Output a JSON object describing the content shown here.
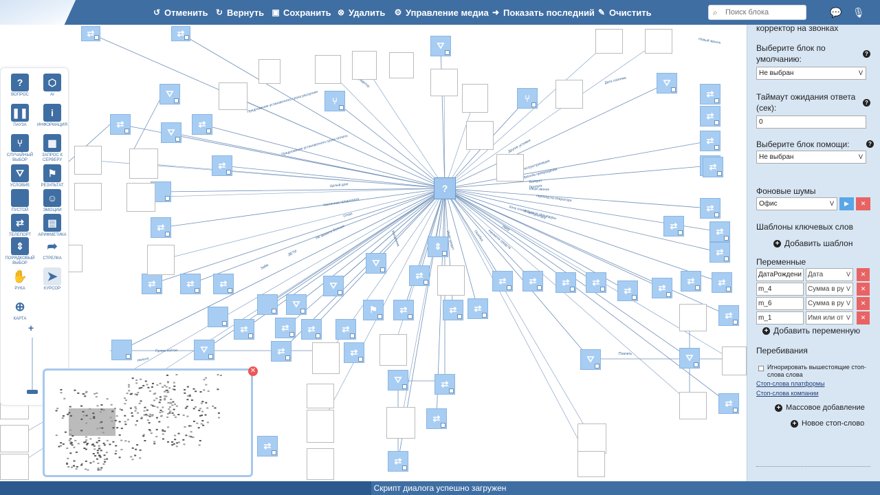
{
  "toolbar": {
    "undo": "Отменить",
    "redo": "Вернуть",
    "save": "Сохранить",
    "delete": "Удалить",
    "media": "Управление медиа",
    "show_last": "Показать последний",
    "clear": "Очистить",
    "search_placeholder": "Поиск блока"
  },
  "tools": [
    {
      "label": "ВОПРОС",
      "glyph": "?"
    },
    {
      "label": "AI",
      "glyph": "⬡"
    },
    {
      "label": "ПАУЗА",
      "glyph": "❚❚"
    },
    {
      "label": "ИНФОРМАЦИЯ",
      "glyph": "i"
    },
    {
      "label": "СЛУЧАЙНЫЙ ВЫБОР",
      "glyph": "⑂"
    },
    {
      "label": "ЗАПРОС К СЕРВЕРУ",
      "glyph": "▦"
    },
    {
      "label": "УСЛОВИЕ",
      "glyph": "⛛"
    },
    {
      "label": "РЕЗУЛЬТАТ",
      "glyph": "⚑"
    },
    {
      "label": "ПУСТОЙ",
      "glyph": ""
    },
    {
      "label": "ЭМОЦИИ",
      "glyph": "☺"
    },
    {
      "label": "ТЕЛЕПОРТ",
      "glyph": "⇄"
    },
    {
      "label": "АРИФМЕТИКА",
      "glyph": "▤"
    },
    {
      "label": "ПОРЯДКОВЫЙ ВЫБОР",
      "glyph": "⇕"
    },
    {
      "label": "СТРЕЛКА",
      "glyph": "➦"
    },
    {
      "label": "РУКА",
      "glyph": "✋"
    },
    {
      "label": "КУРСОР",
      "glyph": "➤"
    },
    {
      "label": "КАРТА",
      "glyph": "⊕"
    }
  ],
  "center_node_glyph": "?",
  "edge_labels": [
    "Предложение установочного срока рассрочки",
    "Предложение установочного срока оплаты",
    "кредитор",
    "Целый долг",
    "Частичная предоплата",
    "Отказ",
    "Не звонить больше",
    "ДЕТИ",
    "Займ",
    "Другие условия",
    "Реструктуризация",
    "Просьба прекращения",
    "Пропуск",
    "Банкрот",
    "Иной звонок",
    "переход на оператора",
    "Хочу отказаться от процедуры",
    "В прокуратуру",
    "Умер",
    "Нехватка средств",
    "Ошибка",
    "Иная кредит",
    "Дата платежа",
    "Новый звонок",
    "Прямо сейчас",
    "Неясно",
    "Платить",
    "Мошенник"
  ],
  "panel": {
    "top_label": "корректор на звонках",
    "default_block_label": "Выберите блок по умолчанию:",
    "default_block_value": "Не выбран",
    "timeout_label": "Таймаут ожидания ответа (сек):",
    "timeout_value": "0",
    "help_block_label": "Выберите блок помощи:",
    "help_block_value": "Не выбран",
    "background_noise_label": "Фоновые шумы",
    "background_noise_value": "Офис",
    "keyword_templates_label": "Шаблоны ключевых слов",
    "add_template": "Добавить шаблон",
    "variables_label": "Переменные",
    "variables": [
      {
        "name": "ДатаРождени",
        "type": "Дата"
      },
      {
        "name": "m_4",
        "type": "Сумма в ру"
      },
      {
        "name": "m_6",
        "type": "Сумма в ру"
      },
      {
        "name": "m_1",
        "type": "Имя или от"
      }
    ],
    "add_variable": "Добавить переменную",
    "interruptions_label": "Перебивания",
    "ignore_stopwords": "Игнорировать вышестоящие стоп-слова слова",
    "platform_stopwords": "Стоп-слова платформы",
    "company_stopwords": "Стоп-слова компании",
    "bulk_add": "Массовое добавление",
    "new_stopword": "Новое стоп-слово"
  },
  "status": "Скрипт диалога успешно загружен",
  "colors": {
    "brand": "#3f6ea3",
    "node": "#a8cdf3",
    "panel_bg": "#d8e6f4",
    "danger": "#e86464"
  }
}
